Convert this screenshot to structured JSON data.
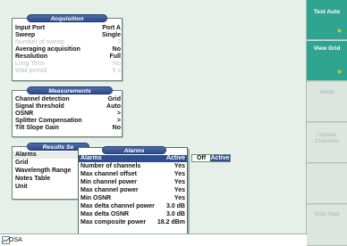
{
  "sidebar": {
    "buttons": [
      {
        "label": "Test Auto",
        "state": "active"
      },
      {
        "label": "View Grid",
        "state": "active"
      },
      {
        "label": "Adopt",
        "state": "inactive"
      },
      {
        "label": "Update Channels",
        "state": "inactive"
      },
      {
        "label": "",
        "state": "inactive"
      },
      {
        "label": "Stop Wait",
        "state": "inactive"
      }
    ]
  },
  "acquisition": {
    "title": "Acquisition",
    "rows": [
      {
        "label": "Input Port",
        "value": "Port A"
      },
      {
        "label": "Sweep",
        "value": "Single"
      },
      {
        "label": "Number of sweep",
        "value": "2"
      },
      {
        "label": "Averaging acquisition",
        "value": "No"
      },
      {
        "label": "Resolution",
        "value": "Full"
      },
      {
        "label": "Long Term",
        "value": "No"
      },
      {
        "label": "Wait period",
        "value": "5 s"
      }
    ]
  },
  "measurements": {
    "title": "Measurements",
    "rows": [
      {
        "label": "Channel detection",
        "value": "Grid"
      },
      {
        "label": "Signal threshold",
        "value": "Auto"
      },
      {
        "label": "OSNR",
        "value": ">"
      },
      {
        "label": "Splitter Compensation",
        "value": ">"
      },
      {
        "label": "Tilt Slope Gain",
        "value": "No"
      }
    ]
  },
  "results": {
    "title": "Results Se",
    "rows": [
      "Alarms",
      "Grid",
      "Wavelength Range",
      "Notes Table",
      "Unit"
    ]
  },
  "alarms": {
    "title": "Alarms",
    "header": {
      "label": "Alarms",
      "value": "Active"
    },
    "rows": [
      {
        "label": "Number of channels",
        "value": "Yes"
      },
      {
        "label": "Max channel offset",
        "value": "Yes"
      },
      {
        "label": "Min channel power",
        "value": "Yes"
      },
      {
        "label": "Max channel power",
        "value": "Yes"
      },
      {
        "label": "Min OSNR",
        "value": "Yes"
      },
      {
        "label": "Max delta channel power",
        "value": "3.0 dB"
      },
      {
        "label": "Max delta OSNR",
        "value": "3.0 dB"
      },
      {
        "label": "Max composite power",
        "value": "18.2 dBm"
      }
    ]
  },
  "toggle": {
    "off": "Off",
    "active": "Active"
  },
  "status": {
    "tab": "OSA"
  },
  "colors": {
    "accent": "#2fa591",
    "title_bar": "#2e4f8b",
    "background": "#e6f0e8"
  }
}
